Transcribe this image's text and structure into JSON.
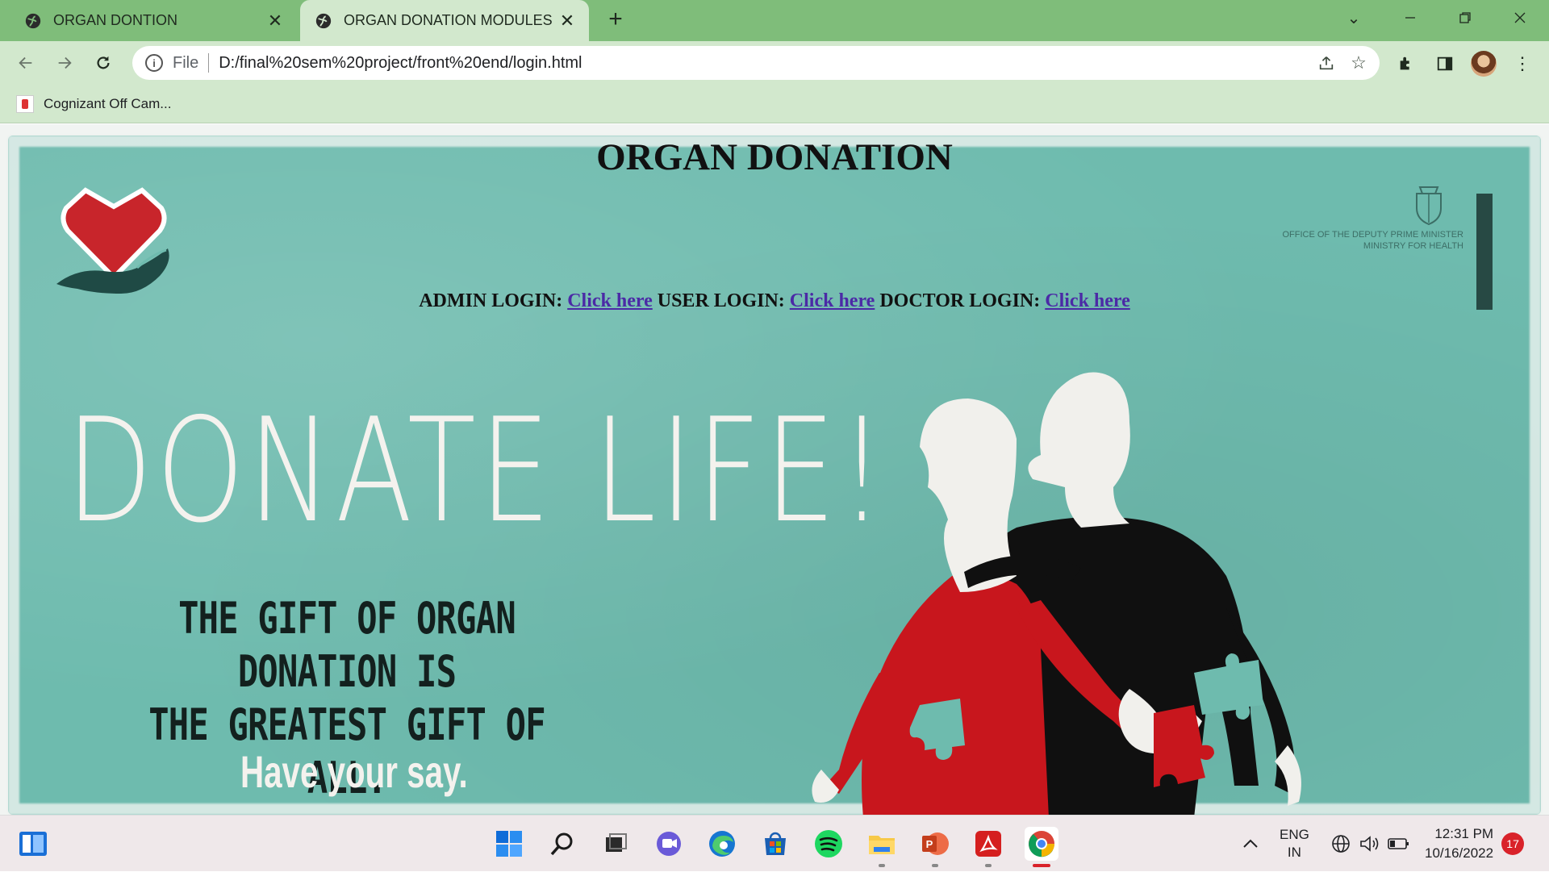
{
  "browser": {
    "tabs": [
      {
        "title": "ORGAN DONTION",
        "active": false
      },
      {
        "title": "ORGAN DONATION MODULES",
        "active": true
      }
    ],
    "new_tab_symbol": "+",
    "address": {
      "scheme_label": "File",
      "url": "D:/final%20sem%20project/front%20end/login.html"
    },
    "bookmarks": [
      {
        "label": "Cognizant Off Cam..."
      }
    ]
  },
  "page": {
    "title": "ORGAN DONATION",
    "logins": [
      {
        "prefix": "ADMIN LOGIN:",
        "link": "Click here"
      },
      {
        "prefix": "USER LOGIN:",
        "link": "Click here"
      },
      {
        "prefix": "DOCTOR LOGIN:",
        "link": "Click here"
      }
    ],
    "poster": {
      "headline": "DONATE LIFE!",
      "tagline_line1": "THE GIFT OF ORGAN DONATION IS",
      "tagline_line2": "THE GREATEST GIFT OF ALL.",
      "footer": "Have your say.",
      "ministry_line1": "OFFICE OF THE DEPUTY PRIME MINISTER",
      "ministry_line2": "MINISTRY FOR HEALTH",
      "colors": {
        "background": "#6ebbae",
        "heart": "#c8252b",
        "shirt_red": "#c8161d",
        "shirt_black": "#101010"
      }
    }
  },
  "taskbar": {
    "ime_line1": "ENG",
    "ime_line2": "IN",
    "time": "12:31 PM",
    "date": "10/16/2022",
    "notifications": "17"
  }
}
